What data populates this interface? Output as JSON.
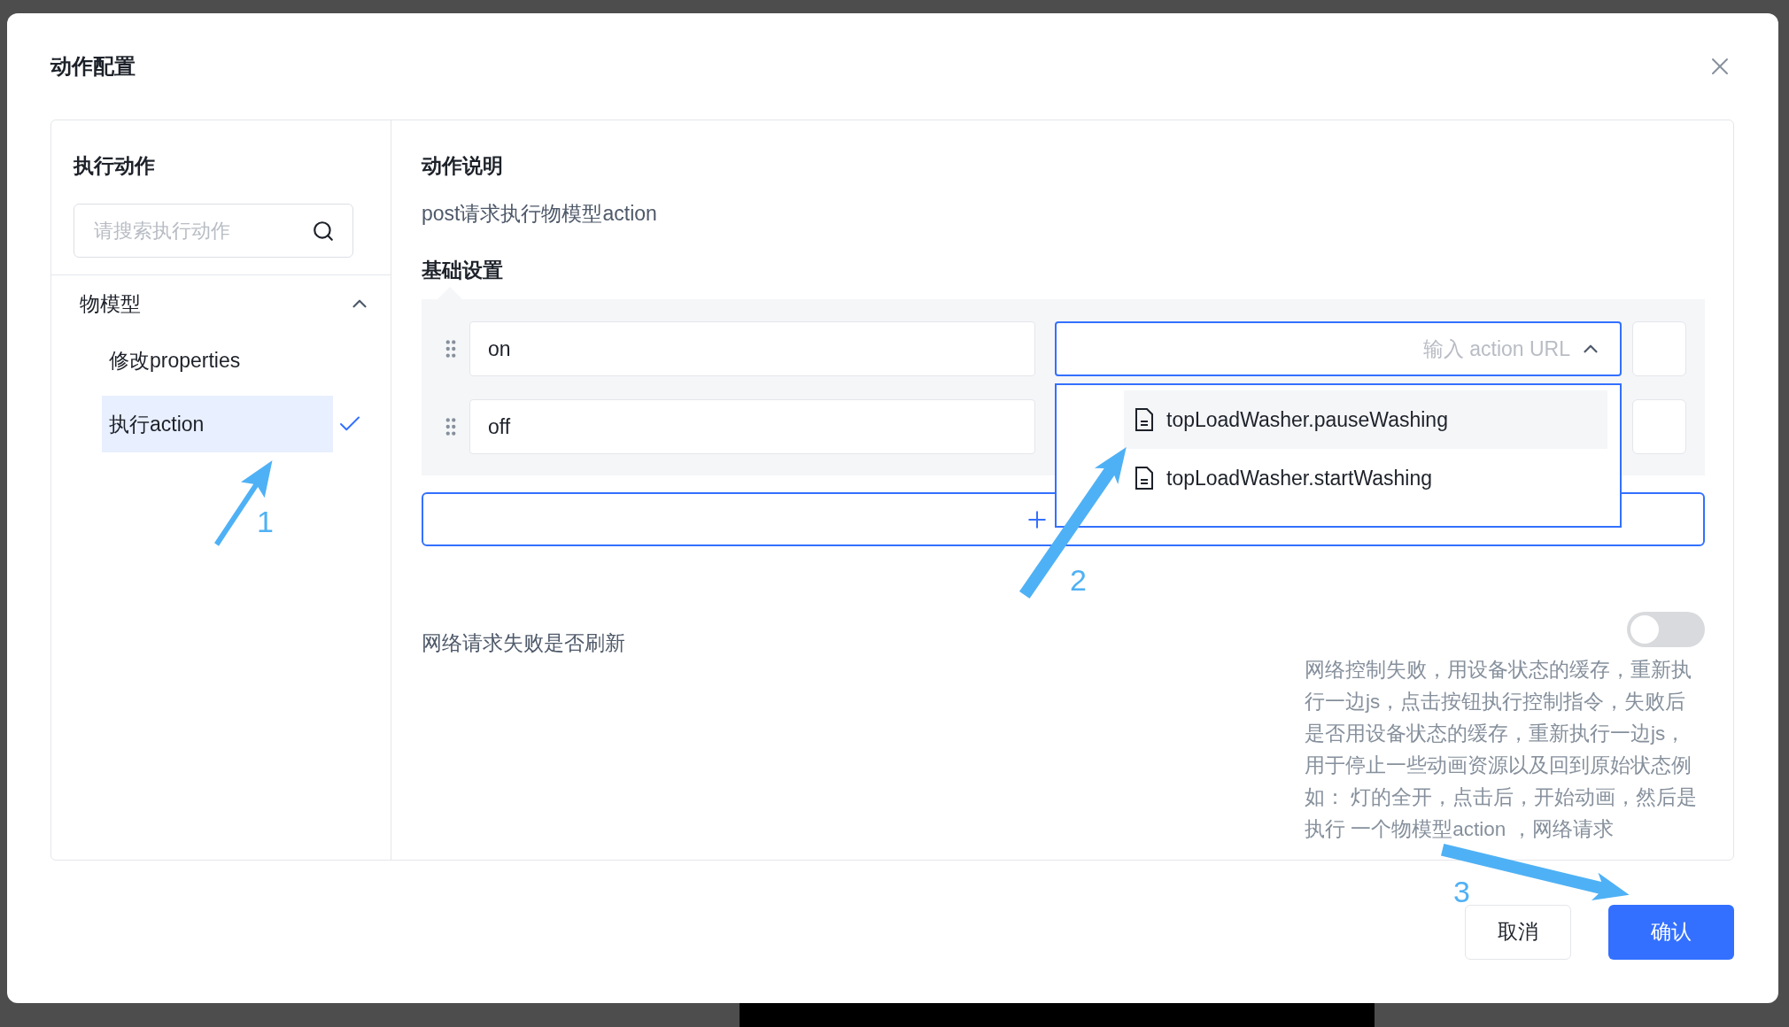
{
  "dialog": {
    "title": "动作配置"
  },
  "actions_panel": {
    "title": "执行动作",
    "search_placeholder": "请搜索执行动作",
    "groups": [
      {
        "label": "物模型",
        "expanded": true,
        "children": [
          {
            "label": "修改properties",
            "selected": false
          },
          {
            "label": "执行action",
            "selected": true
          }
        ]
      }
    ]
  },
  "detail": {
    "description_title": "动作说明",
    "description": "post请求执行物模型action",
    "settings_title": "基础设置",
    "rows": [
      {
        "value": "on",
        "url_placeholder": "输入 action URL",
        "open": true
      },
      {
        "value": "off"
      }
    ],
    "dropdown": {
      "options": [
        {
          "label": "topLoadWasher.pauseWashing",
          "highlighted": true
        },
        {
          "label": "topLoadWasher.startWashing",
          "highlighted": false
        }
      ]
    },
    "refresh": {
      "label": "网络请求失败是否刷新",
      "on": false,
      "help": "网络控制失败，用设备状态的缓存，重新执行一边js，点击按钮执行控制指令，失败后是否用设备状态的缓存，重新执行一边js，用于停止一些动画资源以及回到原始状态例如： 灯的全开，点击后，开始动画，然后是执行 一个物模型action ，网络请求"
    }
  },
  "footer": {
    "buttons": [
      {
        "label": "取消",
        "kind": "default"
      },
      {
        "label": "确认",
        "kind": "primary"
      }
    ]
  },
  "annotations": [
    {
      "number": "1"
    },
    {
      "number": "2"
    },
    {
      "number": "3"
    }
  ]
}
